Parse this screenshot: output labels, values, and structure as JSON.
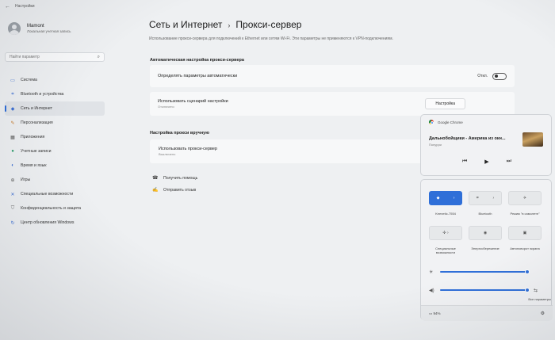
{
  "titlebar": {
    "back": "←",
    "title": "Настройки"
  },
  "user": {
    "name": "Mamont",
    "account_type": "Локальная учетная запись"
  },
  "search": {
    "placeholder": "Найти параметр",
    "icon": "search-icon"
  },
  "sidebar": {
    "items": [
      {
        "label": "Система",
        "icon": "monitor-icon",
        "glyph": "▭"
      },
      {
        "label": "Bluetooth и устройства",
        "icon": "bluetooth-icon",
        "glyph": "⌗"
      },
      {
        "label": "Сеть и Интернет",
        "icon": "wifi-icon",
        "glyph": "◆"
      },
      {
        "label": "Персонализация",
        "icon": "brush-icon",
        "glyph": "✎"
      },
      {
        "label": "Приложения",
        "icon": "apps-icon",
        "glyph": "▦"
      },
      {
        "label": "Учетные записи",
        "icon": "person-icon",
        "glyph": "●"
      },
      {
        "label": "Время и язык",
        "icon": "globe-icon",
        "glyph": "◐"
      },
      {
        "label": "Игры",
        "icon": "gamepad-icon",
        "glyph": "⊕"
      },
      {
        "label": "Специальные возможности",
        "icon": "accessibility-icon",
        "glyph": "✕"
      },
      {
        "label": "Конфиденциальность и защита",
        "icon": "shield-icon",
        "glyph": "⛉"
      },
      {
        "label": "Центр обновления Windows",
        "icon": "update-icon",
        "glyph": "↻"
      }
    ]
  },
  "main": {
    "breadcrumb_parent": "Сеть и Интернет",
    "breadcrumb_sep": "›",
    "breadcrumb_current": "Прокси-сервер",
    "description": "Использование прокси-сервера для подключений к Ethernet или сетям Wi-Fi. Эти параметры не применяются к VPN-подключениям.",
    "auto_section_title": "Автоматическая настройка прокси-сервера",
    "auto_detect_label": "Определять параметры автоматически",
    "auto_detect_state": "Откл.",
    "script_label": "Использовать сценарий настройки",
    "script_sub": "Отключено",
    "script_button": "Настройка",
    "manual_section_title": "Настройка прокси вручную",
    "manual_label": "Использовать прокси-сервер",
    "manual_sub": "Выключено",
    "help_label": "Получить помощь",
    "feedback_label": "Отправить отзыв"
  },
  "media_flyout": {
    "app": "Google Chrome",
    "title": "Дальнобойщики - Америка из окн...",
    "subtitle": "Попурри",
    "prev": "⏮",
    "play": "▶",
    "next": "⏭"
  },
  "quick_settings": {
    "wifi_label": "Keenetic-7554",
    "bluetooth_label": "Bluetooth",
    "airplane_label": "Режим \"в самолете\"",
    "accessibility_label": "Специальные возможности",
    "energy_label": "Энергосбережение",
    "rotation_label": "Автоповорот экрана",
    "brightness_percent": 100,
    "volume_percent": 100,
    "all_settings_label": "Все параметры",
    "battery_label": "94%"
  }
}
